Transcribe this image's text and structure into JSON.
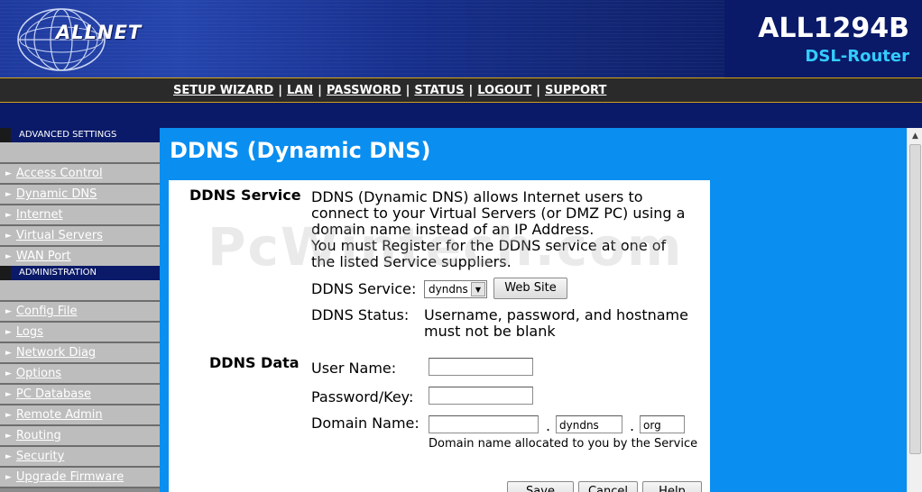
{
  "brand": {
    "logo_text": "ALLNET",
    "model": "ALL1294B",
    "subtitle": "DSL-Router"
  },
  "topnav": {
    "items": [
      "SETUP WIZARD",
      "LAN",
      "PASSWORD",
      "STATUS",
      "LOGOUT",
      "SUPPORT"
    ],
    "separator": "|"
  },
  "sidebar": {
    "advanced_header": "ADVANCED SETTINGS",
    "advanced_items": [
      "Access Control",
      "Dynamic DNS",
      "Internet",
      "Virtual Servers",
      "WAN Port"
    ],
    "admin_header": "ADMINISTRATION",
    "admin_items": [
      "Config File",
      "Logs",
      "Network Diag",
      "Options",
      "PC Database",
      "Remote Admin",
      "Routing",
      "Security",
      "Upgrade Firmware"
    ]
  },
  "main": {
    "title": "DDNS (Dynamic DNS)",
    "service_section_label": "DDNS Service",
    "description": [
      "DDNS (Dynamic DNS) allows Internet users to",
      "connect to your Virtual Servers (or DMZ PC) using a",
      "domain name instead of an IP Address.",
      "You must Register for the DDNS service at one of",
      "the listed Service suppliers."
    ],
    "service_label": "DDNS Service:",
    "service_selected": "dyndns",
    "website_button": "Web Site",
    "status_label": "DDNS Status:",
    "status_line1": "Username, password, and hostname",
    "status_line2": "must not be blank",
    "data_section_label": "DDNS Data",
    "username_label": "User Name:",
    "username_value": "",
    "password_label": "Password/Key:",
    "password_value": "",
    "domain_label": "Domain Name:",
    "domain_host_value": "",
    "domain_mid_value": "dyndns",
    "domain_tld_value": "org",
    "domain_dot": ".",
    "domain_hint": "Domain name allocated to you by the Service",
    "buttons": [
      "Save",
      "Cancel",
      "Help"
    ]
  },
  "watermark": "PcWintech.com",
  "colors": {
    "banner_navy": "#0a1a68",
    "accent_cyan": "#33ccff",
    "main_blue": "#0a8ef0",
    "nav_border_gold": "#d4a017",
    "sidebar_gray": "#bdbdbd"
  }
}
